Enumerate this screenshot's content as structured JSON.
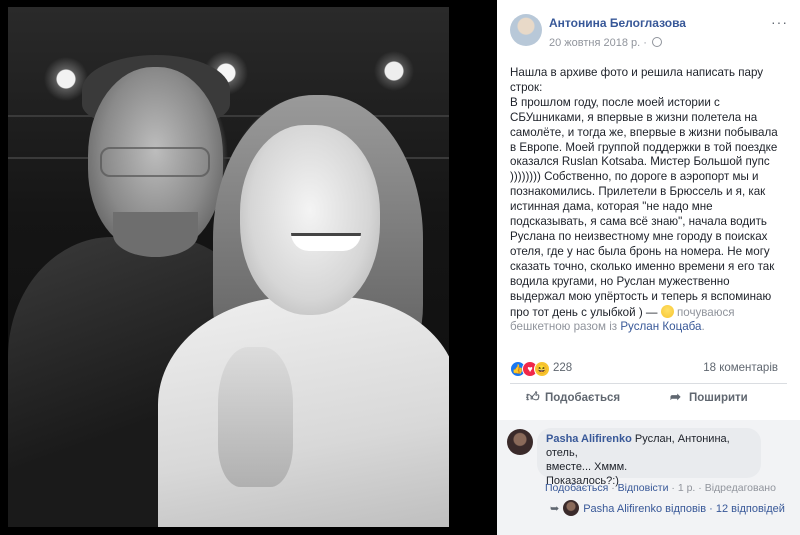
{
  "post": {
    "author": "Антонина Белоглазова",
    "date": "20 жовтня 2018 р.",
    "separator": "·",
    "more": "···",
    "text_lines": [
      "Нашла в архиве фото и решила написать пару",
      "строк:",
      "В прошлом году, после моей истории с",
      "СБУшниками, я впервые в жизни полетела на",
      "самолёте, и тогда же, впервые в жизни побывала",
      "в Европе. Моей группой поддержки в той поездке",
      "оказался Ruslan Kotsaba. Мистер Большой пупс",
      ")))))))) Собственно, по дороге в аэропорт мы и",
      "познакомились. Прилетели в Брюссель и я, как",
      "истинная дама, которая \"не надо мне",
      "подсказывать, я сама всё знаю\", начала водить",
      "Руслана по неизвестному мне городу в поисках",
      "отеля, где у нас была бронь на номера. Не могу",
      "сказать точно, сколько именно времени я его так",
      "водила кругами, но Руслан мужественно",
      "выдержал мою упёртость и теперь я вспоминаю",
      "про тот день с улыбкой ) —"
    ],
    "feeling": "почуваюся",
    "feeling_line2": "бешкетною разом із",
    "tagged": "Руслан Коцаба",
    "tagged_end": "."
  },
  "reactions": {
    "count": "228",
    "comments": "18 коментарів",
    "icons": [
      "like-icon",
      "love-icon",
      "haha-icon"
    ],
    "colors": {
      "like": "#1877f2",
      "love": "#f0284a",
      "haha": "#f7c531"
    }
  },
  "actions": {
    "like_label": "Подобається",
    "share_label": "Поширити"
  },
  "comment": {
    "name": "Pasha Alifirenko",
    "text_line1": " Руслан, Антонина, отель,",
    "text_line2": "вместе... Хммм.",
    "text_line3": "Показалось?:)",
    "like": "Подобається",
    "dot": " · ",
    "reply": "Відповісти",
    "time": "1 р.",
    "edited": "Відредаговано",
    "reply_author": "Pasha Alifirenko",
    "reply_action": "відповів",
    "replies": "12 відповідей"
  },
  "colors": {
    "link": "#385898",
    "text": "#1d2129",
    "muted": "#90949c"
  }
}
